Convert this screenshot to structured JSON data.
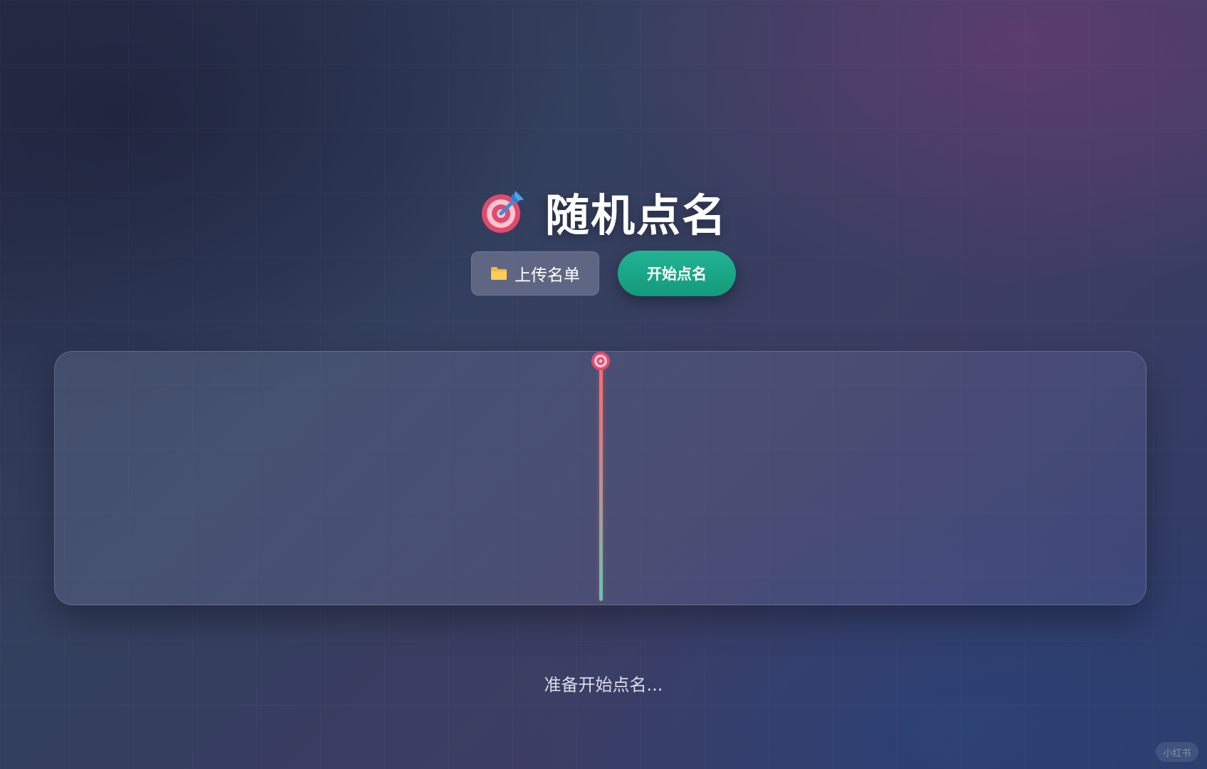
{
  "header": {
    "icon": "dart-target-icon",
    "title": "随机点名"
  },
  "toolbar": {
    "upload_icon": "folder-icon",
    "upload_label": "上传名单",
    "start_label": "开始点名"
  },
  "wheel": {
    "pointer_icon": "target-icon",
    "names": []
  },
  "status": {
    "text": "准备开始点名..."
  },
  "watermark": {
    "text": "小红书"
  },
  "colors": {
    "accent": "#1fa98a",
    "pointer_top": "#ff6a6a",
    "pointer_bottom": "#5fc9b6"
  }
}
